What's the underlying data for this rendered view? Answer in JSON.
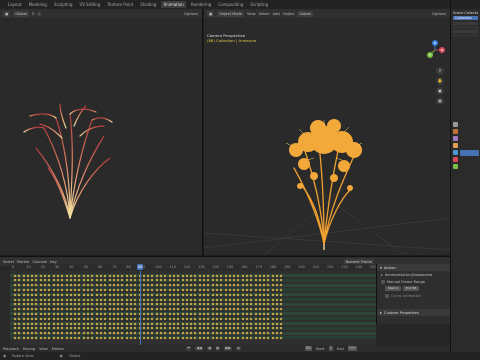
{
  "workspace_tabs": [
    "Layout",
    "Modeling",
    "Sculpting",
    "UV Editing",
    "Texture Paint",
    "Shading",
    "Animation",
    "Rendering",
    "Compositing",
    "Scripting"
  ],
  "active_tab_index": 6,
  "topbar_right": {
    "scene_label": "Scene"
  },
  "left_viewport": {
    "header": {
      "orientation": "Global",
      "options": "Options"
    }
  },
  "right_viewport": {
    "header": {
      "mode": "Object Mode",
      "view": "View",
      "select": "Select",
      "add": "Add",
      "object": "Object",
      "orientation": "Global",
      "options": "Options"
    },
    "overlay_line1": "Camera Perspective",
    "overlay_line2": "(88) Collection | Armature"
  },
  "outliner": {
    "title": "Scene Collection",
    "item": "Collection"
  },
  "timeline": {
    "menu": [
      "Select",
      "Marker",
      "Channel",
      "Key"
    ],
    "dropdown": "Nearest Frame",
    "current_frame": "88",
    "ticks": [
      "0",
      "10",
      "20",
      "30",
      "40",
      "50",
      "60",
      "70",
      "80",
      "90",
      "100",
      "110",
      "120",
      "130",
      "140",
      "150",
      "160",
      "170",
      "180",
      "190",
      "200",
      "210",
      "220",
      "230",
      "240",
      "250"
    ],
    "playhead_frame": 88,
    "frame_max": 250
  },
  "action_panel": {
    "title": "Action",
    "action_name": "ArmatureAction|Shadowview",
    "manual_frame_range": "Manual Frame Range",
    "start_label": "Start",
    "end_label": "End",
    "start_value": "0",
    "end_value": "88",
    "cyclic": "Cyclic Animation",
    "custom_properties": "Custom Properties"
  },
  "playback": {
    "playback_label": "Playback",
    "keying_label": "Keying",
    "view_label": "View",
    "marker_label": "Marker",
    "current": "88",
    "start_label": "Start",
    "start": "1",
    "end_label": "End",
    "end": "250"
  },
  "statusbar": {
    "left": "Rotate View",
    "middle": "Object"
  },
  "colors": {
    "accent": "#4772b3",
    "key_yellow": "#e6b84c",
    "selected_orange": "#f0a030",
    "gizmo_x": "#d84a5a",
    "gizmo_y": "#7ac142",
    "gizmo_z": "#3a7fd9"
  }
}
